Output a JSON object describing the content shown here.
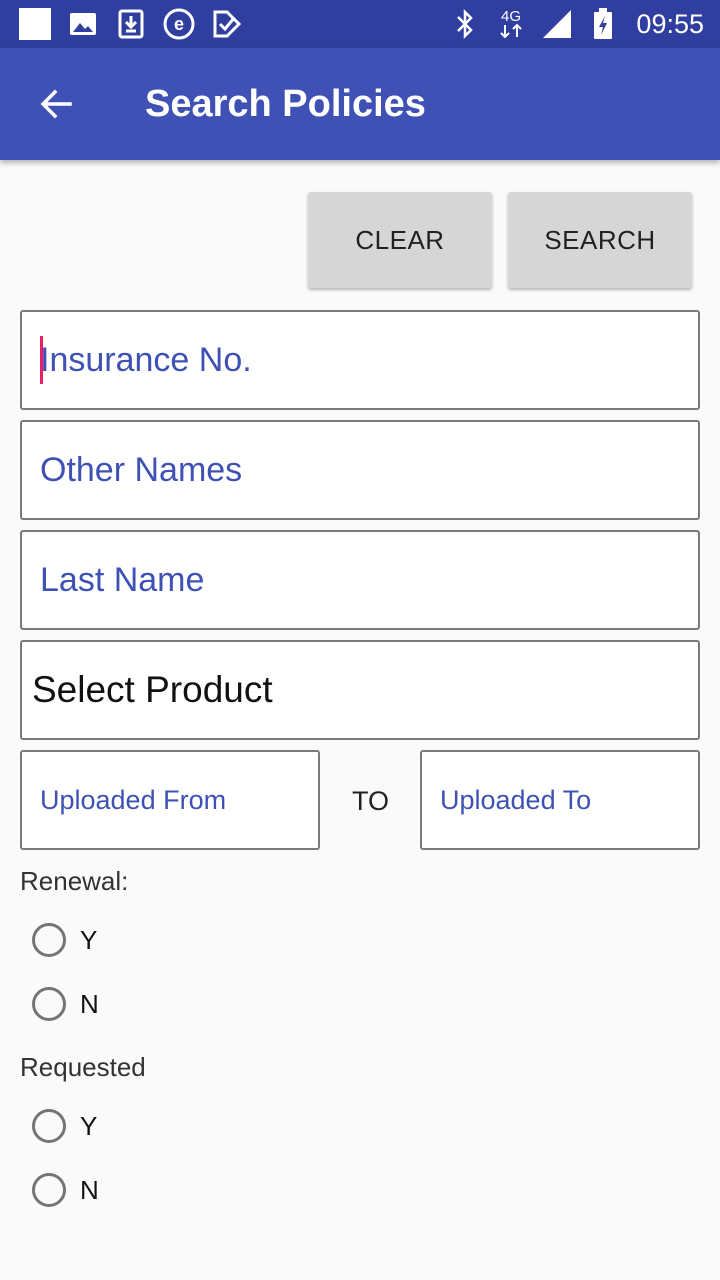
{
  "status_bar": {
    "time": "09:55",
    "network": "4G",
    "left_icons": [
      "square-notification-icon",
      "image-icon",
      "download-icon",
      "e-app-icon",
      "check-app-icon"
    ],
    "right_icons": [
      "bluetooth-icon",
      "network-4g-icon",
      "signal-icon",
      "battery-icon"
    ]
  },
  "app_bar": {
    "title": "Search Policies",
    "back_icon": "arrow-left-icon"
  },
  "actions": {
    "clear_label": "CLEAR",
    "search_label": "SEARCH"
  },
  "form": {
    "insurance_no": {
      "placeholder": "Insurance No.",
      "value": ""
    },
    "other_names": {
      "placeholder": "Other Names",
      "value": ""
    },
    "last_name": {
      "placeholder": "Last Name",
      "value": ""
    },
    "product": {
      "selected": "Select Product"
    },
    "uploaded_from": {
      "placeholder": "Uploaded From",
      "value": ""
    },
    "to_label": "TO",
    "uploaded_to": {
      "placeholder": "Uploaded To",
      "value": ""
    }
  },
  "renewal": {
    "label": "Renewal:",
    "options": [
      "Y",
      "N"
    ]
  },
  "requested": {
    "label": "Requested",
    "options": [
      "Y",
      "N"
    ]
  },
  "colors": {
    "status_bar": "#303f9f",
    "app_bar": "#3f51b5",
    "accent": "#e91e63",
    "button": "#d6d6d6",
    "background": "#fafafa"
  }
}
